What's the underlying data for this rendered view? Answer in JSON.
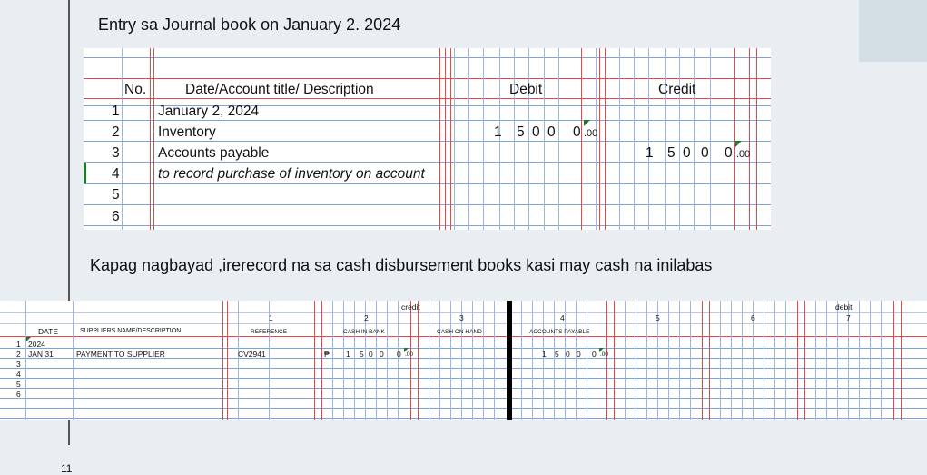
{
  "heading": "Entry sa Journal book on January 2. 2024",
  "caption": "Kapag nagbayad ,irerecord na sa cash disbursement books kasi may cash na inilabas",
  "page_number": "11",
  "journal": {
    "headers": {
      "no": "No.",
      "desc": "Date/Account title/ Description",
      "debit": "Debit",
      "credit": "Credit"
    },
    "rows": [
      {
        "no": "1",
        "desc": "January 2, 2024"
      },
      {
        "no": "2",
        "desc": "Inventory"
      },
      {
        "no": "3",
        "desc": "Accounts payable"
      },
      {
        "no": "4",
        "desc": "to record purchase of inventory on account"
      },
      {
        "no": "5",
        "desc": ""
      },
      {
        "no": "6",
        "desc": ""
      }
    ],
    "amount_digits": [
      "1",
      "5",
      "0",
      "0",
      "0"
    ],
    "cents": ".00"
  },
  "cdb": {
    "group_credit": "credit",
    "group_debit": "debit",
    "col_numbers": [
      "1",
      "2",
      "3",
      "4",
      "5",
      "6",
      "7"
    ],
    "headers": {
      "date": "DATE",
      "supplier": "SUPPLIERS NAME/DESCRIPTION",
      "reference": "REFERENCE",
      "cash_in_bank": "CASH IN BANK",
      "cash_on_hand": "CASH ON HAND",
      "accounts_payable": "ACCOUNTS PAYABLE"
    },
    "row_numbers": [
      "1",
      "2",
      "3",
      "4",
      "5",
      "6"
    ],
    "date_year": "2024",
    "date": "JAN 31",
    "supplier": "PAYMENT TO SUPPLIER",
    "reference": "CV2941",
    "peso": "₱",
    "amount_digits": [
      "1",
      "5",
      "0",
      "0",
      "0"
    ],
    "cents": ".00"
  }
}
